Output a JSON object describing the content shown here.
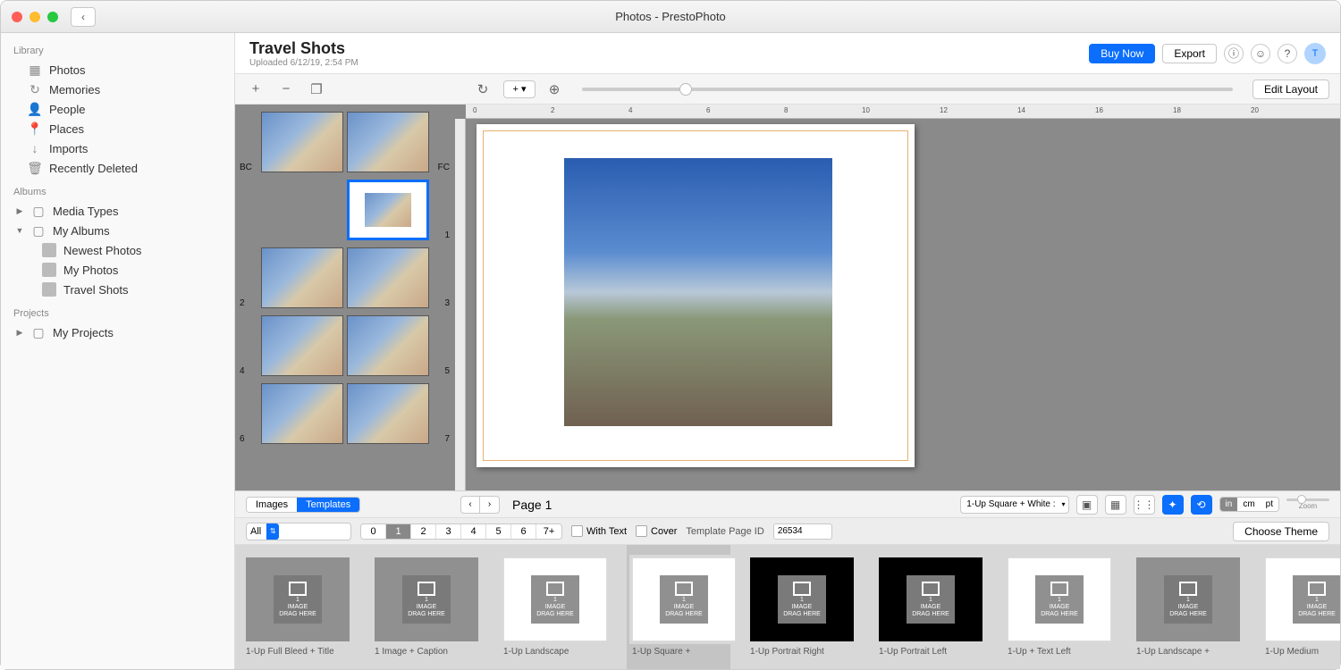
{
  "window": {
    "title": "Photos - PrestoPhoto"
  },
  "sidebar": {
    "sections": {
      "library": {
        "header": "Library",
        "items": [
          "Photos",
          "Memories",
          "People",
          "Places",
          "Imports",
          "Recently Deleted"
        ]
      },
      "albums": {
        "header": "Albums",
        "items": [
          "Media Types",
          "My Albums",
          "Newest Photos",
          "My Photos",
          "Travel Shots"
        ]
      },
      "projects": {
        "header": "Projects",
        "items": [
          "My Projects"
        ]
      }
    }
  },
  "header": {
    "title": "Travel Shots",
    "subtitle": "Uploaded 6/12/19, 2:54 PM",
    "buy": "Buy Now",
    "export": "Export",
    "edit_layout": "Edit Layout",
    "avatar": "T"
  },
  "spreads": {
    "labels": {
      "bc": "BC",
      "fc": "FC",
      "p1": "1",
      "p2": "2",
      "p3": "3",
      "p4": "4",
      "p5": "5",
      "p6": "6",
      "p7": "7"
    }
  },
  "ruler": {
    "marks": [
      "0",
      "2",
      "4",
      "6",
      "8",
      "10",
      "12",
      "14",
      "16",
      "18",
      "20"
    ]
  },
  "bottom": {
    "tabs": {
      "images": "Images",
      "templates": "Templates"
    },
    "page_label": "Page 1",
    "layout_name": "1-Up Square + White :",
    "units": {
      "in": "in",
      "cm": "cm",
      "pt": "pt"
    },
    "zoom_label": "Zoom",
    "filter": {
      "all": "All",
      "nums": [
        "0",
        "1",
        "2",
        "3",
        "4",
        "5",
        "6",
        "7+"
      ]
    },
    "with_text": "With Text",
    "cover": "Cover",
    "tpid_label": "Template Page ID",
    "tpid_value": "26534",
    "choose_theme": "Choose Theme"
  },
  "templates": [
    {
      "label": "1-Up Full Bleed + Title",
      "bg": "gray"
    },
    {
      "label": "1 Image + Caption",
      "bg": "gray"
    },
    {
      "label": "1-Up Landscape",
      "bg": "white"
    },
    {
      "label": "1-Up Square +",
      "bg": "white",
      "selected": true
    },
    {
      "label": "1-Up Portrait Right",
      "bg": "black"
    },
    {
      "label": "1-Up Portrait Left",
      "bg": "black"
    },
    {
      "label": "1-Up + Text Left",
      "bg": "white"
    },
    {
      "label": "1-Up Landscape +",
      "bg": "gray"
    },
    {
      "label": "1-Up Medium",
      "bg": "white"
    }
  ],
  "drag": {
    "count": "1",
    "image": "IMAGE",
    "here": "DRAG HERE"
  }
}
